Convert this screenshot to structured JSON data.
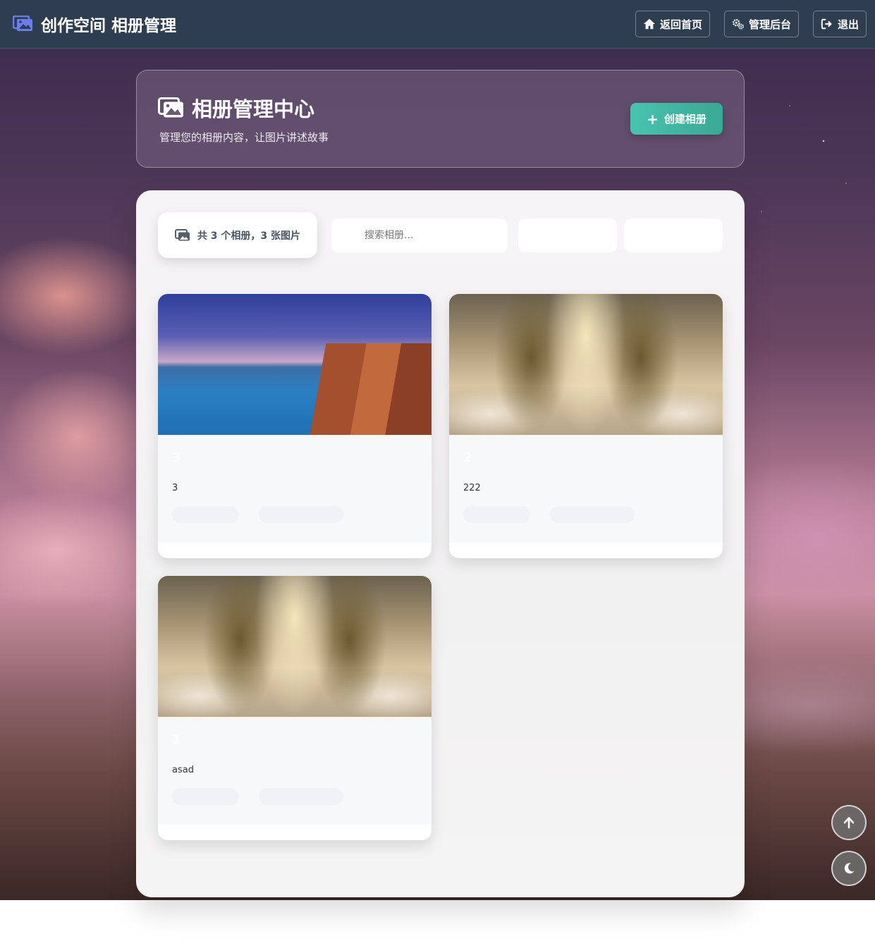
{
  "navbar": {
    "title": "创作空间 相册管理",
    "buttons": [
      {
        "label": "返回首页",
        "icon": "home-icon"
      },
      {
        "label": "管理后台",
        "icon": "gears-icon"
      },
      {
        "label": "退出",
        "icon": "logout-icon"
      }
    ]
  },
  "header": {
    "title": "相册管理中心",
    "subtitle": "管理您的相册内容，让图片讲述故事",
    "create_label": "创建相册"
  },
  "toolbar": {
    "stats": "共 3 个相册，3 张图片",
    "search_placeholder": "搜索相册..."
  },
  "albums": [
    {
      "title": "3",
      "description": "3",
      "cover": "coastal-cliff-photo"
    },
    {
      "title": "2",
      "description": "222",
      "cover": "fantasy-castle-photo"
    },
    {
      "title": "1",
      "description": "asad",
      "cover": "fantasy-castle-photo"
    }
  ],
  "colors": {
    "navbar": "#2e3e50",
    "accent": "#48c3b0",
    "brand_icon": "#6c7cf0"
  }
}
